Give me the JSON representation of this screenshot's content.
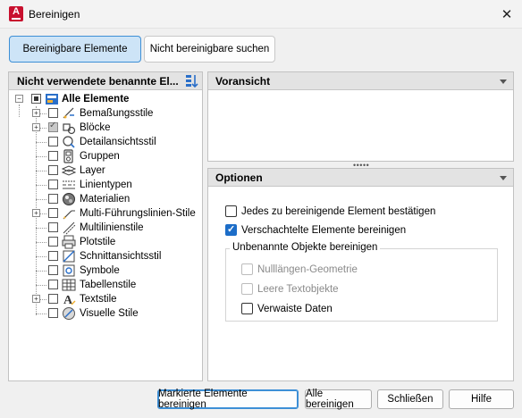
{
  "window": {
    "title": "Bereinigen"
  },
  "tabs": [
    {
      "label": "Bereinigbare Elemente",
      "active": true
    },
    {
      "label": "Nicht bereinigbare suchen",
      "active": false
    }
  ],
  "left_panel": {
    "header": "Nicht verwendete benannte El..."
  },
  "tree": {
    "root": {
      "label": "Alle Elemente"
    },
    "items": [
      {
        "label": "Bemaßungsstile",
        "icon": "dimension-style-icon",
        "expandable": true,
        "checked": false
      },
      {
        "label": "Blöcke",
        "icon": "block-icon",
        "expandable": true,
        "checked": true
      },
      {
        "label": "Detailansichtsstil",
        "icon": "detail-view-style-icon",
        "expandable": false,
        "checked": false
      },
      {
        "label": "Gruppen",
        "icon": "group-icon",
        "expandable": false,
        "checked": false
      },
      {
        "label": "Layer",
        "icon": "layer-icon",
        "expandable": false,
        "checked": false
      },
      {
        "label": "Linientypen",
        "icon": "linetype-icon",
        "expandable": false,
        "checked": false
      },
      {
        "label": "Materialien",
        "icon": "material-icon",
        "expandable": false,
        "checked": false
      },
      {
        "label": "Multi-Führungslinien-Stile",
        "icon": "multileader-style-icon",
        "expandable": true,
        "checked": false
      },
      {
        "label": "Multilinienstile",
        "icon": "multiline-style-icon",
        "expandable": false,
        "checked": false
      },
      {
        "label": "Plotstile",
        "icon": "plot-style-icon",
        "expandable": false,
        "checked": false
      },
      {
        "label": "Schnittansichtsstil",
        "icon": "section-view-style-icon",
        "expandable": false,
        "checked": false
      },
      {
        "label": "Symbole",
        "icon": "symbol-icon",
        "expandable": false,
        "checked": false
      },
      {
        "label": "Tabellenstile",
        "icon": "table-style-icon",
        "expandable": false,
        "checked": false
      },
      {
        "label": "Textstile",
        "icon": "text-style-icon",
        "expandable": true,
        "checked": false
      },
      {
        "label": "Visuelle Stile",
        "icon": "visual-style-icon",
        "expandable": false,
        "checked": false
      }
    ]
  },
  "preview_panel": {
    "header": "Voransicht"
  },
  "options_panel": {
    "header": "Optionen",
    "confirm_each": {
      "label": "Jedes zu bereinigende Element bestätigen",
      "checked": false
    },
    "nested": {
      "label": "Verschachtelte Elemente bereinigen",
      "checked": true
    },
    "unnamed_group": {
      "title": "Unbenannte Objekte bereinigen",
      "zero_length": {
        "label": "Nulllängen-Geometrie",
        "checked": false,
        "enabled": false
      },
      "empty_text": {
        "label": "Leere Textobjekte",
        "checked": false,
        "enabled": false
      },
      "orphaned_data": {
        "label": "Verwaiste Daten",
        "checked": false,
        "enabled": true
      }
    }
  },
  "buttons": {
    "purge_checked": "Markierte Elemente bereinigen",
    "purge_all": "Alle bereinigen",
    "close": "Schließen",
    "help": "Hilfe"
  }
}
